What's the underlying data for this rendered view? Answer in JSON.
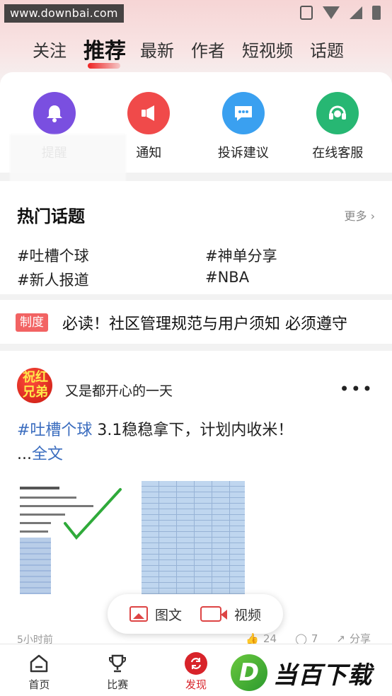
{
  "status_bar": {
    "watermark": "www.downbai.com"
  },
  "tabs": [
    {
      "label": "关注"
    },
    {
      "label": "推荐",
      "active": true
    },
    {
      "label": "最新"
    },
    {
      "label": "作者"
    },
    {
      "label": "短视频"
    },
    {
      "label": "话题"
    }
  ],
  "shortcuts": [
    {
      "label": "提醒",
      "icon": "bell-icon",
      "color": "#7a4fe0"
    },
    {
      "label": "通知",
      "icon": "megaphone-icon",
      "color": "#f04a4a"
    },
    {
      "label": "投诉建议",
      "icon": "chat-bubble-icon",
      "color": "#3aa0f0"
    },
    {
      "label": "在线客服",
      "icon": "headset-icon",
      "color": "#27b773"
    }
  ],
  "hot_topics": {
    "title": "热门话题",
    "more": "更多",
    "items": [
      "#吐槽个球",
      "#神单分享",
      "#新人报道",
      "#NBA"
    ]
  },
  "rule_banner": {
    "badge": "制度",
    "text": "必读！社区管理规范与用户须知 必须遵守"
  },
  "post": {
    "avatar_text": "祝红兄弟",
    "author": "又是都开心的一天",
    "tag": "#吐槽个球",
    "text": " 3.1稳稳拿下，计划内收米！",
    "ellipsis": "...",
    "full_link": "全文",
    "time": "5小时前",
    "likes": "24",
    "comments": "7",
    "share": "分享"
  },
  "float_bar": {
    "image_text": "图文",
    "video": "视频"
  },
  "bottom_nav": [
    {
      "label": "首页",
      "icon": "home-icon"
    },
    {
      "label": "比赛",
      "icon": "trophy-icon"
    },
    {
      "label": "发现",
      "icon": "discover-icon",
      "active": true
    },
    {
      "label": "",
      "icon": ""
    },
    {
      "label": "",
      "icon": ""
    }
  ],
  "brand_watermark": {
    "letter": "D",
    "text": "当百下载"
  },
  "colors": {
    "accent": "#d8232a",
    "link": "#3b6dbf",
    "badge": "#f26363"
  }
}
